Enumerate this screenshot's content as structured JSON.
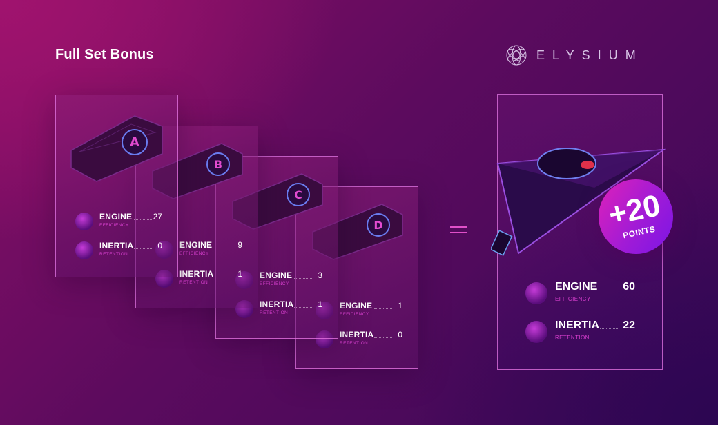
{
  "header": {
    "title": "Full Set Bonus",
    "logo_text": "ELYSIUM"
  },
  "cards": [
    {
      "letter": "A",
      "engine": {
        "label": "ENGINE",
        "sub": "EFFICIENCY",
        "value": "27"
      },
      "inertia": {
        "label": "INERTIA",
        "sub": "RETENTION",
        "value": "0"
      }
    },
    {
      "letter": "B",
      "engine": {
        "label": "ENGINE",
        "sub": "EFFICIENCY",
        "value": "9"
      },
      "inertia": {
        "label": "INERTIA",
        "sub": "RETENTION",
        "value": "1"
      }
    },
    {
      "letter": "C",
      "engine": {
        "label": "ENGINE",
        "sub": "EFFICIENCY",
        "value": "3"
      },
      "inertia": {
        "label": "INERTIA",
        "sub": "RETENTION",
        "value": "1"
      }
    },
    {
      "letter": "D",
      "engine": {
        "label": "ENGINE",
        "sub": "EFFICIENCY",
        "value": "1"
      },
      "inertia": {
        "label": "INERTIA",
        "sub": "RETENTION",
        "value": "0"
      }
    }
  ],
  "result": {
    "bonus_value": "+20",
    "bonus_label": "POINTS",
    "engine": {
      "label": "ENGINE",
      "sub": "EFFICIENCY",
      "value": "60"
    },
    "inertia": {
      "label": "INERTIA",
      "sub": "RETENTION",
      "value": "22"
    }
  },
  "icons": {
    "engine": "lightning-icon",
    "inertia": "swirl-icon"
  },
  "colors": {
    "accent": "#d83fcf",
    "border": "#e678e6",
    "bonus_start": "#e021b8",
    "bonus_end": "#7a15e6"
  }
}
